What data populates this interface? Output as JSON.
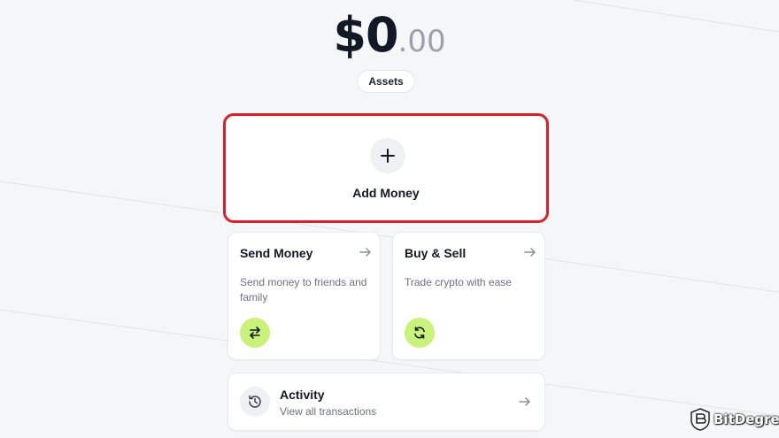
{
  "balance": {
    "whole": "$0",
    "cents": ".00"
  },
  "assets_button": {
    "label": "Assets"
  },
  "add_money": {
    "label": "Add Money",
    "icon": "plus-icon"
  },
  "cards": {
    "send": {
      "title": "Send Money",
      "desc": "Send money to friends and family",
      "icon": "swap-arrows-icon"
    },
    "buy_sell": {
      "title": "Buy & Sell",
      "desc": "Trade crypto with ease",
      "icon": "refresh-icon"
    }
  },
  "activity": {
    "title": "Activity",
    "subtitle": "View all transactions",
    "icon": "history-icon"
  },
  "watermark": {
    "text": "BitDegree"
  },
  "colors": {
    "accent": "#c8f27a",
    "highlight": "#d8202a",
    "background": "#f5f6f8"
  }
}
